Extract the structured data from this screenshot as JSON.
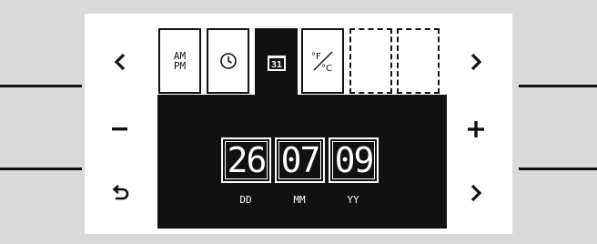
{
  "tabs": [
    {
      "id": "ampm",
      "line1": "AM",
      "line2": "PM"
    },
    {
      "id": "clock",
      "icon": "clock-icon"
    },
    {
      "id": "calendar",
      "icon": "calendar-icon",
      "label": "31",
      "active": true
    },
    {
      "id": "temp-unit",
      "icon": "fahrenheit-celsius-icon",
      "deg1": "°F",
      "deg2": "°C"
    },
    {
      "id": "empty-1"
    },
    {
      "id": "empty-2"
    }
  ],
  "date": {
    "day": "26",
    "month": "07",
    "year": "09",
    "day_label": "DD",
    "month_label": "MM",
    "year_label": "YY"
  },
  "nav": {
    "left_top": "chevron-left-icon",
    "left_mid": "minus-icon",
    "left_bottom": "back-arrow-icon",
    "right_top": "chevron-right-icon",
    "right_mid": "plus-icon",
    "right_bottom": "chevron-right-icon"
  },
  "colors": {
    "background": "#d9d9d9",
    "panel": "#ffffff",
    "display": "#111111",
    "foreground": "#ffffff"
  }
}
